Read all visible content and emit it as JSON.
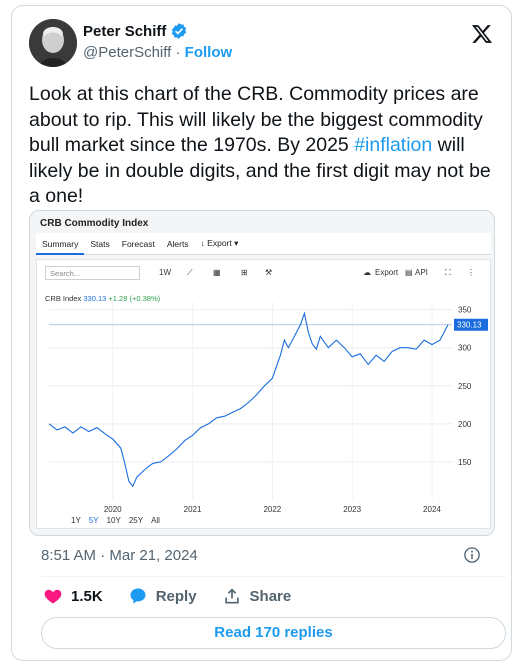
{
  "author": {
    "name": "Peter Schiff",
    "handle": "@PeterSchiff",
    "follow_label": "Follow",
    "verified": true,
    "brand_icon": "x-logo-icon"
  },
  "tweet": {
    "text_before": "Look at this chart of the CRB. Commodity prices are about to rip. This will likely be the biggest commodity bull market since the 1970s. By 2025 ",
    "hashtag": "#inflation",
    "text_after": " will likely be in double digits, and the first digit may not be a one!"
  },
  "media": {
    "title": "CRB Commodity Index",
    "tabs": [
      "Summary",
      "Stats",
      "Forecast",
      "Alerts",
      "↓ Export ▾"
    ],
    "active_tab": "Summary",
    "search_placeholder": "Search...",
    "interval_label": "1W",
    "export_label": "Export",
    "api_label": "API",
    "symbol": "CRB Index",
    "last_value": "330.13",
    "change": "+1.28 (+0.38%)",
    "ranges": [
      "1Y",
      "5Y",
      "10Y",
      "25Y",
      "All"
    ],
    "selected_range": "5Y",
    "accent_color": "#1a6ddc"
  },
  "chart_data": {
    "type": "line",
    "title": "CRB Commodity Index",
    "series": [
      {
        "name": "CRB Index",
        "x": [
          2019.2,
          2019.3,
          2019.4,
          2019.5,
          2019.6,
          2019.7,
          2019.8,
          2019.9,
          2020.0,
          2020.1,
          2020.15,
          2020.2,
          2020.25,
          2020.3,
          2020.4,
          2020.5,
          2020.6,
          2020.7,
          2020.8,
          2020.9,
          2021.0,
          2021.1,
          2021.2,
          2021.3,
          2021.4,
          2021.5,
          2021.6,
          2021.7,
          2021.8,
          2021.9,
          2022.0,
          2022.1,
          2022.15,
          2022.2,
          2022.3,
          2022.35,
          2022.4,
          2022.45,
          2022.5,
          2022.55,
          2022.6,
          2022.7,
          2022.8,
          2022.9,
          2023.0,
          2023.1,
          2023.2,
          2023.3,
          2023.4,
          2023.5,
          2023.6,
          2023.7,
          2023.8,
          2023.9,
          2024.0,
          2024.1,
          2024.2
        ],
        "y": [
          200,
          192,
          196,
          188,
          196,
          190,
          195,
          187,
          180,
          168,
          148,
          125,
          118,
          130,
          140,
          148,
          150,
          158,
          167,
          178,
          185,
          195,
          200,
          208,
          210,
          215,
          220,
          228,
          238,
          250,
          260,
          290,
          310,
          300,
          320,
          330,
          345,
          320,
          305,
          298,
          315,
          300,
          310,
          300,
          288,
          292,
          278,
          290,
          282,
          295,
          300,
          300,
          298,
          310,
          304,
          310,
          330
        ]
      }
    ],
    "yticks": [
      150,
      200,
      250,
      300,
      350
    ],
    "xticks": [
      "2020",
      "2021",
      "2022",
      "2023",
      "2024"
    ],
    "ylim": [
      100,
      360
    ],
    "xlim": [
      2019.2,
      2024.25
    ],
    "grid": true
  },
  "footer": {
    "time": "8:51 AM · Mar 21, 2024",
    "likes": "1.5K",
    "reply_label": "Reply",
    "share_label": "Share",
    "read_replies": "Read 170 replies"
  },
  "colors": {
    "like": "#f91880",
    "reply": "#1d9bf0",
    "link": "#1d9bf0"
  }
}
